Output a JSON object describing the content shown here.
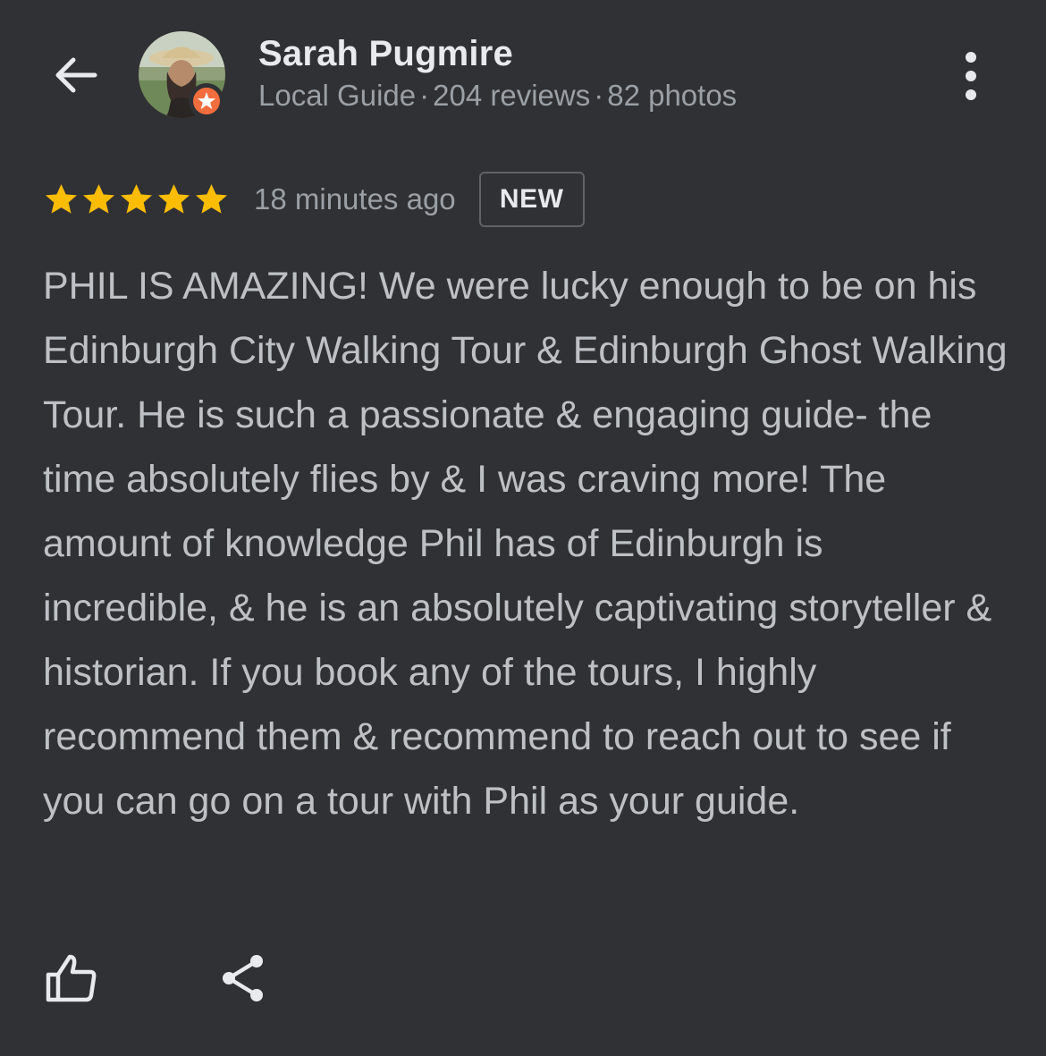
{
  "reviewer": {
    "name": "Sarah Pugmire",
    "level": "Local Guide",
    "reviews": "204 reviews",
    "photos": "82 photos",
    "separator": "·"
  },
  "review": {
    "rating": 5,
    "time_ago": "18 minutes ago",
    "badge": "NEW",
    "text": "PHIL IS AMAZING! We were lucky enough to be on his Edinburgh City Walking Tour & Edinburgh Ghost Walking Tour. He is such a passionate & engaging guide- the time absolutely flies by & I was craving more! The amount of knowledge Phil has of Edinburgh is incredible, & he is an absolutely captivating storyteller & historian. If you book any of the tours, I highly recommend them & recommend to reach out to see if you can go on a tour with Phil as your guide."
  },
  "icons": {
    "back": "arrow-back-icon",
    "more": "more-vert-icon",
    "like": "thumb-up-icon",
    "share": "share-icon",
    "star": "star-icon",
    "guide_badge": "local-guide-badge-icon"
  },
  "colors": {
    "background": "#303134",
    "star": "#fbbc04",
    "badge": "#f26d3d",
    "text_primary": "#e8eaed",
    "text_secondary": "#9aa0a6",
    "text_body": "#bdc1c6"
  }
}
